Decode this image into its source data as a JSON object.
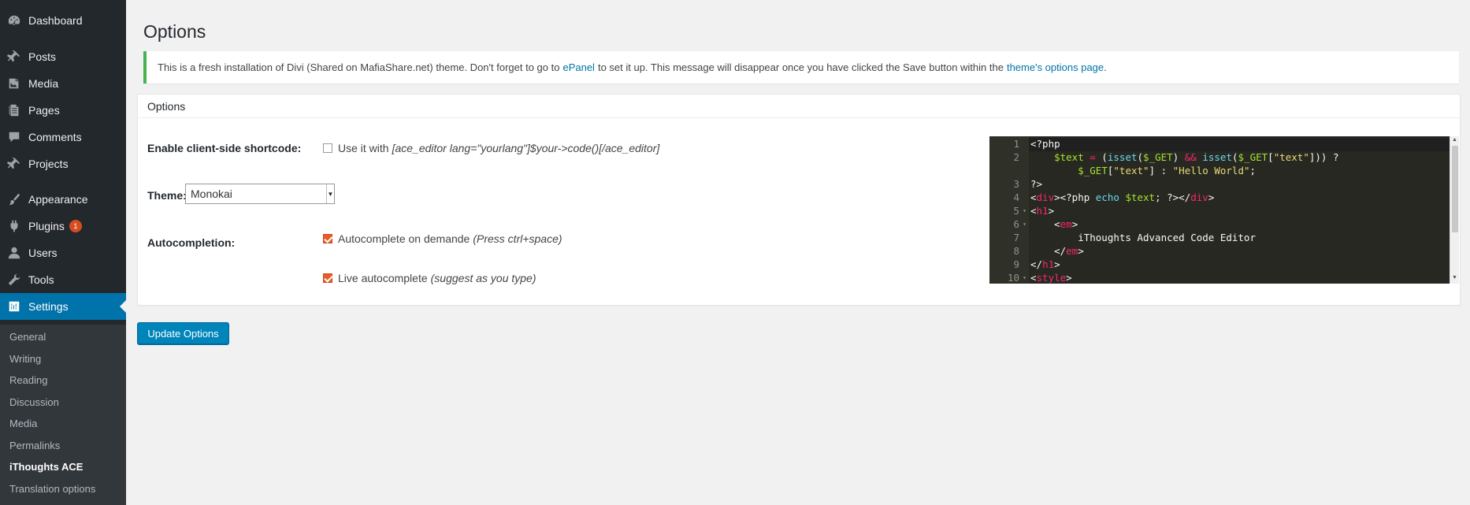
{
  "sidebar": {
    "items": [
      {
        "label": "Dashboard",
        "icon": "dashboard-icon"
      },
      {
        "label": "Posts",
        "icon": "pin-icon"
      },
      {
        "label": "Media",
        "icon": "media-icon"
      },
      {
        "label": "Pages",
        "icon": "pages-icon"
      },
      {
        "label": "Comments",
        "icon": "comment-icon"
      },
      {
        "label": "Projects",
        "icon": "pin-icon"
      },
      {
        "label": "Appearance",
        "icon": "paintbrush-icon"
      },
      {
        "label": "Plugins",
        "icon": "plugin-icon",
        "badge": "1"
      },
      {
        "label": "Users",
        "icon": "user-icon"
      },
      {
        "label": "Tools",
        "icon": "wrench-icon"
      },
      {
        "label": "Settings",
        "icon": "settings-icon"
      }
    ],
    "submenu": [
      "General",
      "Writing",
      "Reading",
      "Discussion",
      "Media",
      "Permalinks",
      "iThoughts ACE",
      "Translation options"
    ]
  },
  "page": {
    "title": "Options"
  },
  "notice": {
    "text_before": "This is a fresh installation of Divi (Shared on MafiaShare.net) theme. Don't forget to go to",
    "link1": "ePanel",
    "text_middle": "to set it up. This message will disappear once you have clicked the Save button within the",
    "link2": "theme's options page",
    "text_after": "."
  },
  "options_box": {
    "header": "Options",
    "shortcode_label": "Enable client-side shortcode:",
    "shortcode_text": "Use it with",
    "shortcode_hint": "[ace_editor lang=\"yourlang\"]$your->code()[/ace_editor]",
    "theme_label": "Theme:",
    "theme_value": "Monokai",
    "autocompletion_label": "Autocompletion:",
    "autocomplete_text": "Autocomplete on demande",
    "autocomplete_hint": "(Press ctrl+space)",
    "live_text": "Live autocomplete",
    "live_hint": "(suggest as you type)"
  },
  "editor": {
    "line_numbers": [
      "1",
      "2",
      "",
      "3",
      "4",
      "5",
      "6",
      "7",
      "8",
      "9",
      "10"
    ]
  },
  "update_button": "Update Options"
}
